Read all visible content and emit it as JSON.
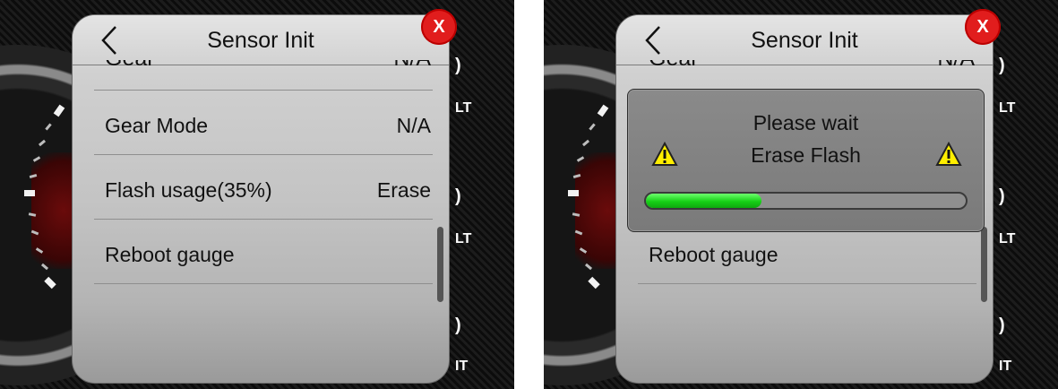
{
  "left_screen": {
    "title": "Sensor Init",
    "partial_row": {
      "label": "Gear",
      "value": "N/A"
    },
    "rows": [
      {
        "label": "Gear Mode",
        "value": "N/A"
      },
      {
        "label": "Flash usage(35%)",
        "value": "Erase"
      },
      {
        "label": "Reboot gauge",
        "value": ""
      }
    ],
    "close_label": "X",
    "side_labels": [
      ")",
      "LT",
      ")",
      "LT",
      ")",
      "IT"
    ]
  },
  "right_screen": {
    "title": "Sensor Init",
    "partial_row": {
      "label": "Gear",
      "value": "N/A"
    },
    "rows": [
      {
        "label": "Reboot gauge",
        "value": ""
      }
    ],
    "close_label": "X",
    "side_labels": [
      ")",
      "LT",
      ")",
      "LT",
      ")",
      "IT"
    ],
    "dialog": {
      "line1": "Please wait",
      "line2": "Erase Flash",
      "progress": 0.36
    }
  },
  "colors": {
    "close": "#e11d1d",
    "progress": "#17d017",
    "warning": "#ffee00"
  },
  "icons": [
    "back-chevron-icon",
    "close-icon",
    "warning-icon",
    "gauge-background"
  ]
}
